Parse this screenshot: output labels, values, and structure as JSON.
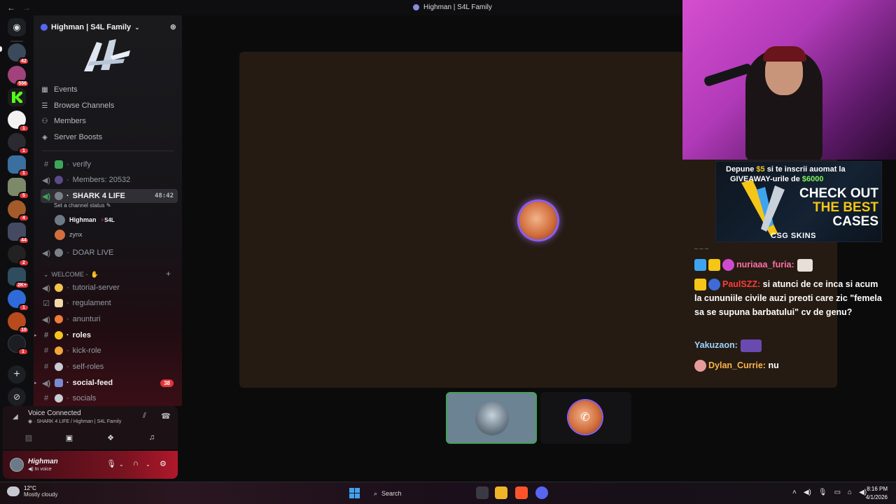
{
  "window": {
    "title": "Highman | S4L Family"
  },
  "server": {
    "name": "Highman | S4L Family"
  },
  "rail": {
    "badges": [
      "42",
      "556",
      "1",
      "1",
      "1",
      "5",
      "4",
      "44",
      "2",
      "2K+",
      "1",
      "10",
      "1"
    ]
  },
  "menu": {
    "events": "Events",
    "browse": "Browse Channels",
    "members": "Members",
    "boosts": "Server Boosts"
  },
  "channels": {
    "verify": "verify",
    "members_count": "Members: 20532",
    "shark": "SHARK 4 LIFE",
    "shark_time": "48:42",
    "shark_status": "Set a channel status",
    "doar": "DOAR LIVE",
    "category": "WELCOME -",
    "tutorial": "tutorial-server",
    "regulament": "regulament",
    "anunturi": "anunturi",
    "roles": "roles",
    "kick": "kick-role",
    "self": "self-roles",
    "social_feed": "social-feed",
    "social_feed_badge": "38",
    "socials": "socials"
  },
  "voice_users": [
    {
      "name": "Highman",
      "tag": "S4L"
    },
    {
      "name": "zynx"
    }
  ],
  "voice_panel": {
    "title": "Voice Connected",
    "subtitle": "SHARK 4 LIFE / Highman | S4L Family"
  },
  "user": {
    "name": "Highman",
    "status": "In voice"
  },
  "ad": {
    "line1_a": "Depune ",
    "line1_amount": "$5",
    "line1_b": " si te inscrii auomat la",
    "line2_a": "GIVEAWAY-urile de ",
    "line2_amount": "$6000",
    "big1": "CHECK OUT",
    "big2": "THE BEST",
    "big3": "CASES",
    "logo": "CSG SKINS"
  },
  "chat": [
    {
      "user": "_ _ _",
      "text": ""
    },
    {
      "user": "nuriaaa_furia:",
      "text": ""
    },
    {
      "user": "PaulSZZ:",
      "text": "si atunci de ce inca si acum la cununiile civile auzi preoti care zic \"femela sa se supuna barbatului\" cv de genu?"
    },
    {
      "user": "Yakuzaon:",
      "text": ""
    },
    {
      "user": "Dylan_Currie:",
      "text": "nu"
    }
  ],
  "taskbar": {
    "temp": "12°C",
    "weather": "Mostly cloudy",
    "search": "Search",
    "time": "8:16 PM",
    "date": "4/1/2026"
  },
  "colors": {
    "accent": "#5865f2",
    "live_green": "#43a25a",
    "badge_red": "#e2333a"
  }
}
